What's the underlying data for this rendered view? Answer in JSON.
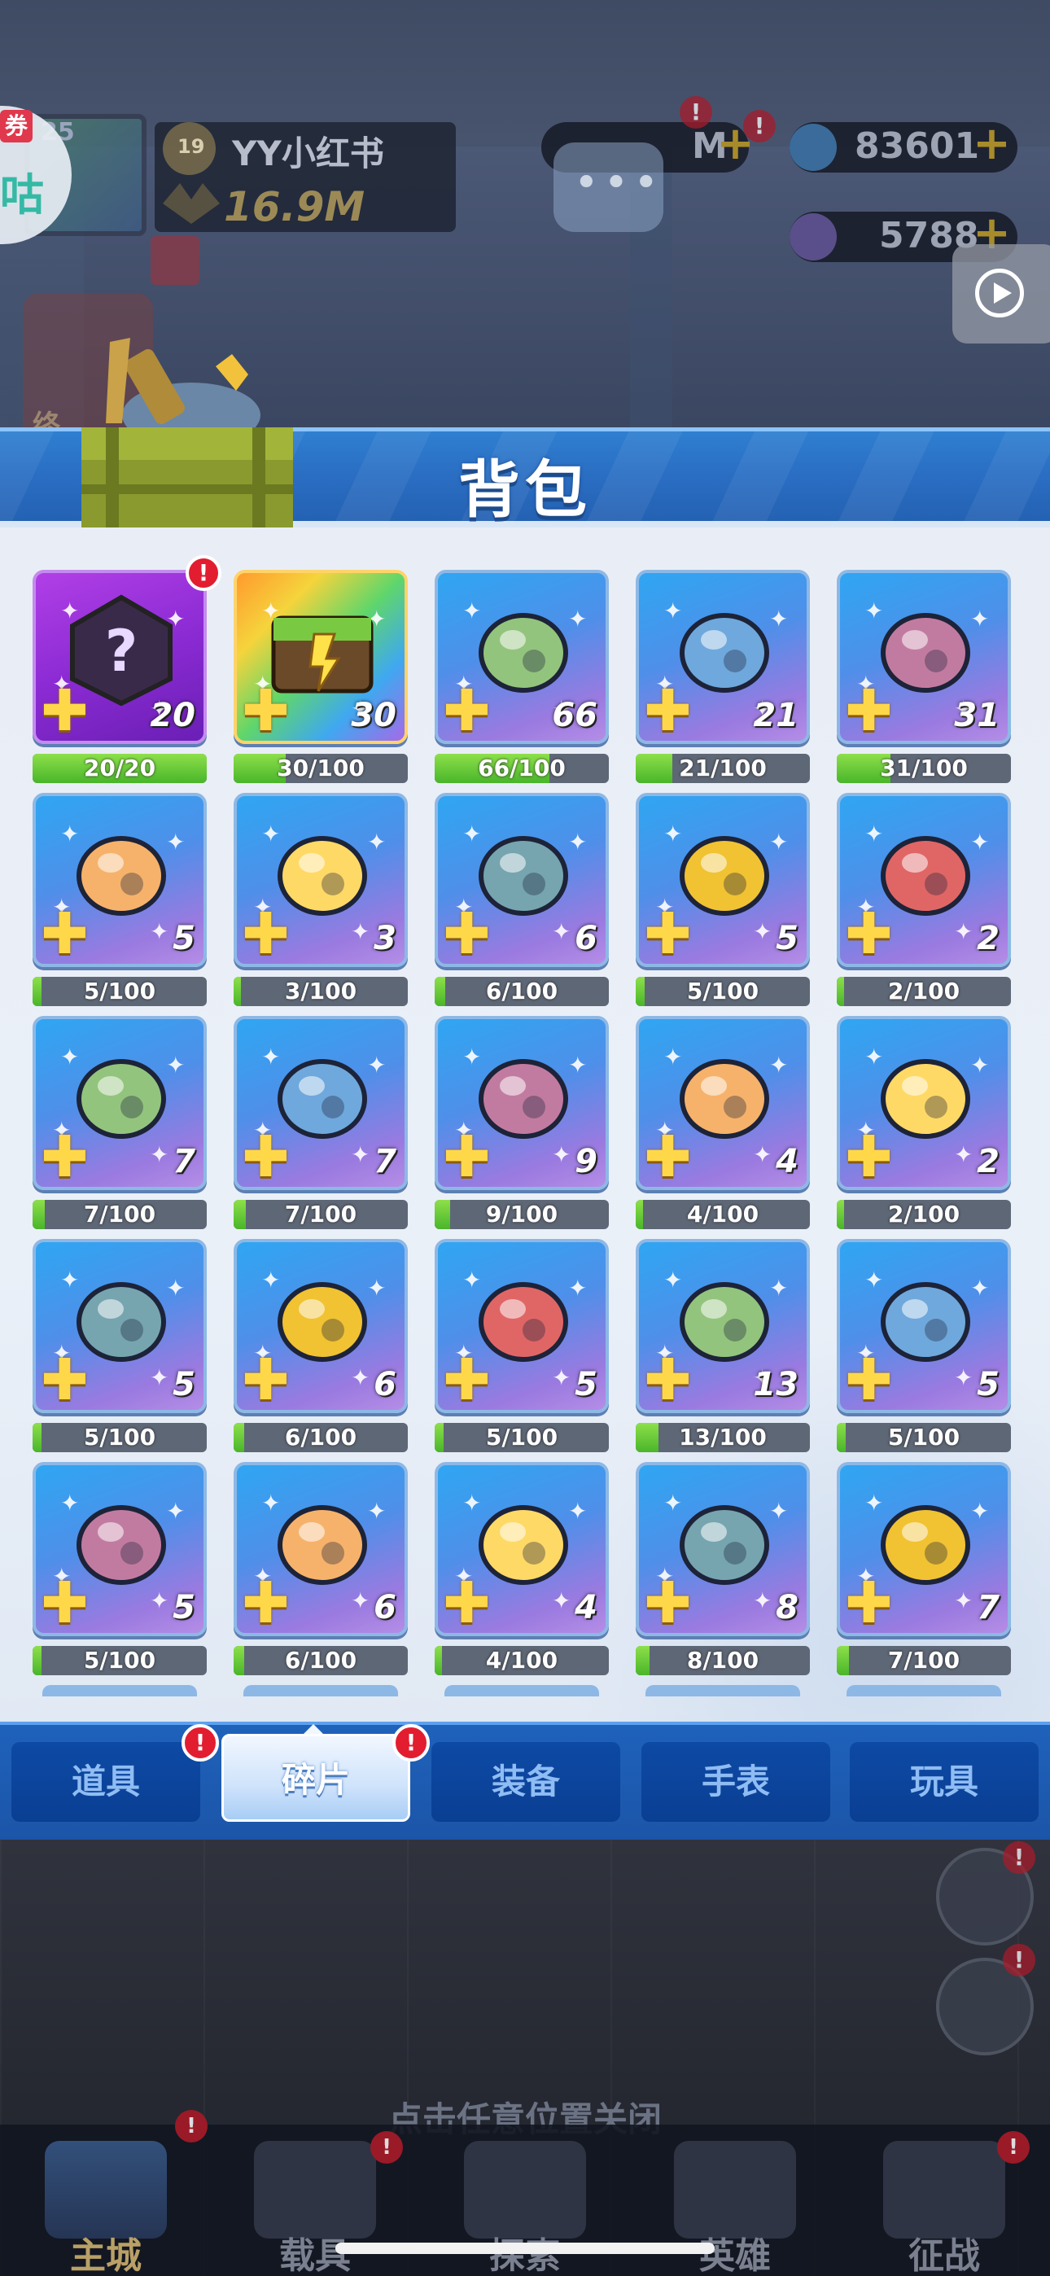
{
  "background": {
    "coupon_label": "券",
    "coupon_text": "咕",
    "player": {
      "level_text": "25",
      "rank_level": "19",
      "name": "YY小红书",
      "power": "16.9M"
    },
    "currencies": [
      {
        "value": "M",
        "icon": "gold-coin-icon"
      },
      {
        "value": "83601",
        "icon": "blue-gem-icon"
      },
      {
        "value": "5788",
        "icon": "badge-coin-icon"
      }
    ],
    "hero_portrait_label": "终"
  },
  "panel": {
    "title": "背包",
    "items": [
      {
        "name": "mystery-fragment",
        "count": "20",
        "progress": "20/20",
        "fill": 1.0,
        "tile": "purple",
        "alert": true
      },
      {
        "name": "rainbow-chest",
        "count": "30",
        "progress": "30/100",
        "fill": 0.3,
        "tile": "rainbow"
      },
      {
        "name": "visor-gear",
        "count": "66",
        "progress": "66/100",
        "fill": 0.66,
        "tile": "blue"
      },
      {
        "name": "golden-trophy",
        "count": "21",
        "progress": "21/100",
        "fill": 0.21,
        "tile": "blue"
      },
      {
        "name": "robot-orb",
        "count": "31",
        "progress": "31/100",
        "fill": 0.31,
        "tile": "blue"
      },
      {
        "name": "game-console",
        "count": "5",
        "progress": "5/100",
        "fill": 0.05,
        "tile": "blue"
      },
      {
        "name": "green-blade",
        "count": "3",
        "progress": "3/100",
        "fill": 0.03,
        "tile": "blue"
      },
      {
        "name": "armor-shield",
        "count": "6",
        "progress": "6/100",
        "fill": 0.06,
        "tile": "blue"
      },
      {
        "name": "winged-helmet",
        "count": "5",
        "progress": "5/100",
        "fill": 0.05,
        "tile": "blue"
      },
      {
        "name": "blue-drone",
        "count": "2",
        "progress": "2/100",
        "fill": 0.02,
        "tile": "blue"
      },
      {
        "name": "dark-bird",
        "count": "7",
        "progress": "7/100",
        "fill": 0.07,
        "tile": "blue"
      },
      {
        "name": "golden-cannon",
        "count": "7",
        "progress": "7/100",
        "fill": 0.07,
        "tile": "blue"
      },
      {
        "name": "metal-hammer",
        "count": "9",
        "progress": "9/100",
        "fill": 0.09,
        "tile": "blue"
      },
      {
        "name": "silver-chain",
        "count": "4",
        "progress": "4/100",
        "fill": 0.04,
        "tile": "blue"
      },
      {
        "name": "red-crystal-horn",
        "count": "2",
        "progress": "2/100",
        "fill": 0.02,
        "tile": "blue"
      },
      {
        "name": "shark-trident",
        "count": "5",
        "progress": "5/100",
        "fill": 0.05,
        "tile": "blue"
      },
      {
        "name": "red-claw",
        "count": "6",
        "progress": "6/100",
        "fill": 0.06,
        "tile": "blue"
      },
      {
        "name": "ice-cube-cluster",
        "count": "5",
        "progress": "5/100",
        "fill": 0.05,
        "tile": "blue"
      },
      {
        "name": "golden-disc",
        "count": "13",
        "progress": "13/100",
        "fill": 0.13,
        "tile": "blue"
      },
      {
        "name": "red-blaster",
        "count": "5",
        "progress": "5/100",
        "fill": 0.05,
        "tile": "blue"
      },
      {
        "name": "golden-key-cross",
        "count": "5",
        "progress": "5/100",
        "fill": 0.05,
        "tile": "blue"
      },
      {
        "name": "steel-sword",
        "count": "6",
        "progress": "6/100",
        "fill": 0.06,
        "tile": "blue"
      },
      {
        "name": "spinning-top",
        "count": "4",
        "progress": "4/100",
        "fill": 0.04,
        "tile": "blue"
      },
      {
        "name": "star-guitar",
        "count": "8",
        "progress": "8/100",
        "fill": 0.08,
        "tile": "blue"
      },
      {
        "name": "crystal-wing",
        "count": "7",
        "progress": "7/100",
        "fill": 0.07,
        "tile": "blue"
      }
    ],
    "tabs": [
      {
        "label": "道具",
        "active": false,
        "alert": true
      },
      {
        "label": "碎片",
        "active": true,
        "alert": true
      },
      {
        "label": "装备",
        "active": false,
        "alert": false
      },
      {
        "label": "手表",
        "active": false,
        "alert": false
      },
      {
        "label": "玩具",
        "active": false,
        "alert": false
      }
    ],
    "alert_symbol": "!"
  },
  "close_hint": "点击任意位置关闭",
  "bottom_nav": [
    {
      "label": "主城",
      "alert": true
    },
    {
      "label": "载具",
      "alert": true
    },
    {
      "label": "探索",
      "alert": false
    },
    {
      "label": "英雄",
      "alert": false
    },
    {
      "label": "征战",
      "alert": true
    }
  ],
  "colors": {
    "panel_blue": "#2a6ec3",
    "tab_inactive": "#0d4aa5",
    "progress_green": "#49b52a",
    "alert_red": "#e21d30",
    "plus_gold": "#ffd84a"
  }
}
